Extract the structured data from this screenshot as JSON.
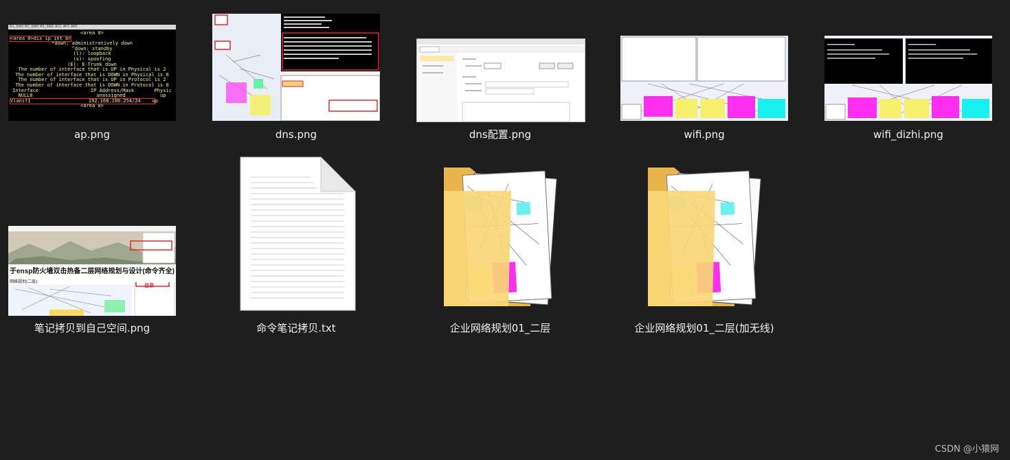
{
  "files": [
    {
      "name": "ap.png",
      "kind": "image",
      "thumbnail": "terminal-screenshot"
    },
    {
      "name": "dns.png",
      "kind": "image",
      "thumbnail": "topology-with-terminal"
    },
    {
      "name": "dns配置.png",
      "kind": "image",
      "thumbnail": "server-config-window"
    },
    {
      "name": "wifi.png",
      "kind": "image",
      "thumbnail": "dual-config-topology"
    },
    {
      "name": "wifi_dizhi.png",
      "kind": "image",
      "thumbnail": "dual-terminal-topology"
    },
    {
      "name": "笔记拷贝到自己空间.png",
      "kind": "image",
      "thumbnail": "blog-page"
    },
    {
      "name": "命令笔记拷贝.txt",
      "kind": "text-document",
      "thumbnail": "document-icon"
    },
    {
      "name": "企业网络规划01_二层",
      "kind": "folder",
      "thumbnail": "folder-icon"
    },
    {
      "name": "企业网络规划01_二层(加无线)",
      "kind": "folder",
      "thumbnail": "folder-icon"
    }
  ],
  "ap_terminal": {
    "tabs": [
      "R1_SW3",
      "R2_SW3",
      "R3_SW3",
      "AC1",
      "AP1",
      "AP2"
    ],
    "lines": [
      "<area 0>",
      "<area 0>dis ip int br",
      "*down: administratively down",
      "^down: standby",
      "(l): loopback",
      "(s): spoofing",
      "(E): E-Trunk down",
      "The number of interface that is UP in Physical is 2",
      "The number of interface that is DOWN in Physical is 0",
      "The number of interface that is UP in Protocol is 2",
      "The number of interface that is DOWN in Protocol is 0",
      "",
      "Interface                  IP Address/Mask       Physic",
      "NULL0                      unassigned            up",
      "Vlanif1                    192.168.100.254/24    up",
      "",
      "<area 0>"
    ]
  },
  "blog": {
    "title": "于ensp防火墙双击热备二层网络规划与设计(命令齐全)",
    "subtitle": "网络规划(二层):",
    "toc_label": "目录"
  },
  "colors": {
    "background": "#1e1e1e",
    "label": "#f0f0f0",
    "highlight": "#e0282e",
    "folder": "#f8d775"
  },
  "watermark": "CSDN @小猿网"
}
